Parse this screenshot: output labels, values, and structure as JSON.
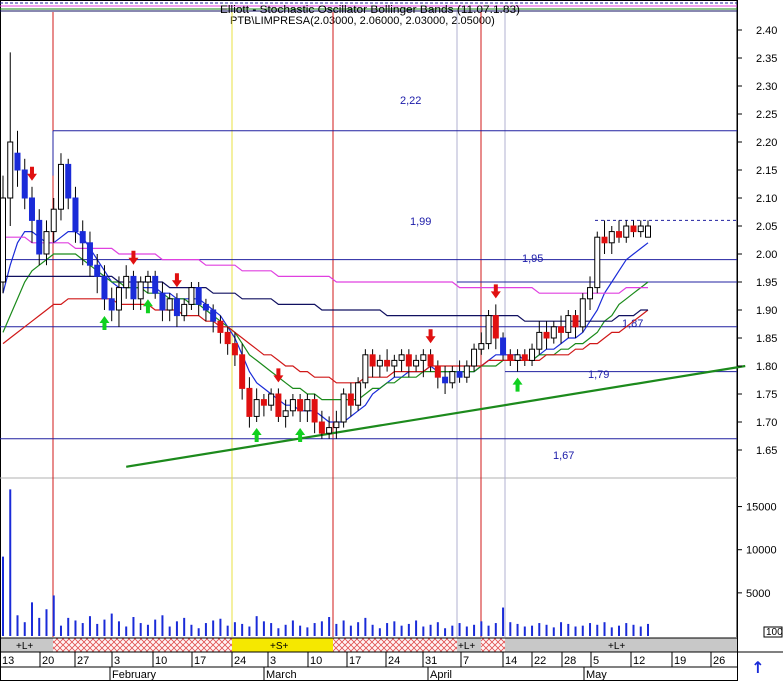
{
  "header": {
    "overlay_text": "Elliott - Stochastic Oscillator Bollinger Bands (11.07.1.83)",
    "instrument": "PTB\\LIMPRESA(2.03000, 2.06000, 2.03000, 2.05000)"
  },
  "colors": {
    "up_candle": "#ffffff",
    "down_candle_a": "#1a2bd8",
    "down_candle_b": "#e01010",
    "ma_fast": "#1a2bd8",
    "ma_mid": "#1a8a1a",
    "ma_slow": "#d01818",
    "ma_long": "#101060",
    "ma_envelope": "#e040e0",
    "trendline": "#1c8a1c",
    "level_line": "#2020a0",
    "vline_red": "#d01818",
    "vline_yellow": "#e8e040",
    "buy_arrow": "#10d020",
    "sell_arrow": "#e01010"
  },
  "signal_band": {
    "labels": [
      "+L+",
      "+S+",
      "+L+",
      "+L+"
    ],
    "zoom_label": "100"
  },
  "scroll_up_icon": "↑",
  "chart_data": {
    "type": "candlestick",
    "title": "PTB\\LIMPRESA(2.03000, 2.06000, 2.03000, 2.05000)",
    "price_axis": {
      "ticks": [
        "2.40",
        "2.35",
        "2.30",
        "2.25",
        "2.20",
        "2.15",
        "2.10",
        "2.05",
        "2.00",
        "1.95",
        "1.90",
        "1.85",
        "1.80",
        "1.75",
        "1.70",
        "1.65"
      ],
      "ylim": [
        1.63,
        2.44
      ],
      "position": "right"
    },
    "volume_axis": {
      "ticks": [
        "15000",
        "10000",
        "5000"
      ],
      "ylim": [
        0,
        17500
      ],
      "position": "right"
    },
    "x_axis": {
      "day_labels": [
        "13",
        "20",
        "27",
        "3",
        "10",
        "17",
        "24",
        "3",
        "10",
        "17",
        "24",
        "31",
        "7",
        "14",
        "22",
        "28",
        "5",
        "12",
        "19",
        "26"
      ],
      "month_labels": [
        "February",
        "March",
        "April",
        "May"
      ]
    },
    "levels": [
      {
        "value": 2.22,
        "label": "2,22"
      },
      {
        "value": 1.99,
        "label": "1,99"
      },
      {
        "value": 1.95,
        "label": "1,95"
      },
      {
        "value": 1.87,
        "label": "1,87"
      },
      {
        "value": 1.79,
        "label": "1,79"
      },
      {
        "value": 1.67,
        "label": "1,67"
      }
    ],
    "candles": [
      [
        1.95,
        2.14,
        1.93,
        2.1
      ],
      [
        2.1,
        2.36,
        2.05,
        2.2
      ],
      [
        2.18,
        2.22,
        2.12,
        2.15
      ],
      [
        2.15,
        2.17,
        2.08,
        2.1
      ],
      [
        2.1,
        2.12,
        2.02,
        2.06
      ],
      [
        2.06,
        2.08,
        1.98,
        2.0
      ],
      [
        2.0,
        2.06,
        1.98,
        2.04
      ],
      [
        2.04,
        2.1,
        2.02,
        2.08
      ],
      [
        2.08,
        2.18,
        2.06,
        2.16
      ],
      [
        2.16,
        2.17,
        2.08,
        2.1
      ],
      [
        2.1,
        2.12,
        2.02,
        2.04
      ],
      [
        2.04,
        2.06,
        1.98,
        2.02
      ],
      [
        2.02,
        2.04,
        1.96,
        1.98
      ],
      [
        1.98,
        2.0,
        1.93,
        1.96
      ],
      [
        1.96,
        1.98,
        1.9,
        1.92
      ],
      [
        1.92,
        1.94,
        1.88,
        1.9
      ],
      [
        1.9,
        1.96,
        1.87,
        1.94
      ],
      [
        1.94,
        1.98,
        1.92,
        1.96
      ],
      [
        1.96,
        1.97,
        1.9,
        1.92
      ],
      [
        1.92,
        1.96,
        1.9,
        1.95
      ],
      [
        1.95,
        1.97,
        1.93,
        1.96
      ],
      [
        1.96,
        1.97,
        1.92,
        1.93
      ],
      [
        1.93,
        1.95,
        1.88,
        1.9
      ],
      [
        1.9,
        1.93,
        1.88,
        1.92
      ],
      [
        1.92,
        1.93,
        1.87,
        1.89
      ],
      [
        1.89,
        1.92,
        1.88,
        1.91
      ],
      [
        1.91,
        1.95,
        1.9,
        1.94
      ],
      [
        1.94,
        1.95,
        1.89,
        1.91
      ],
      [
        1.91,
        1.92,
        1.88,
        1.9
      ],
      [
        1.9,
        1.91,
        1.86,
        1.88
      ],
      [
        1.88,
        1.89,
        1.84,
        1.86
      ],
      [
        1.86,
        1.87,
        1.82,
        1.84
      ],
      [
        1.84,
        1.86,
        1.8,
        1.82
      ],
      [
        1.82,
        1.84,
        1.74,
        1.76
      ],
      [
        1.76,
        1.78,
        1.69,
        1.71
      ],
      [
        1.71,
        1.76,
        1.7,
        1.74
      ],
      [
        1.74,
        1.75,
        1.71,
        1.73
      ],
      [
        1.73,
        1.76,
        1.72,
        1.75
      ],
      [
        1.75,
        1.76,
        1.7,
        1.71
      ],
      [
        1.71,
        1.74,
        1.69,
        1.72
      ],
      [
        1.72,
        1.75,
        1.71,
        1.74
      ],
      [
        1.74,
        1.75,
        1.7,
        1.72
      ],
      [
        1.72,
        1.75,
        1.7,
        1.74
      ],
      [
        1.74,
        1.75,
        1.68,
        1.7
      ],
      [
        1.7,
        1.72,
        1.67,
        1.68
      ],
      [
        1.68,
        1.71,
        1.67,
        1.69
      ],
      [
        1.69,
        1.72,
        1.67,
        1.7
      ],
      [
        1.7,
        1.76,
        1.69,
        1.75
      ],
      [
        1.75,
        1.77,
        1.71,
        1.73
      ],
      [
        1.73,
        1.78,
        1.72,
        1.77
      ],
      [
        1.77,
        1.83,
        1.76,
        1.82
      ],
      [
        1.82,
        1.83,
        1.78,
        1.8
      ],
      [
        1.8,
        1.82,
        1.78,
        1.81
      ],
      [
        1.81,
        1.83,
        1.79,
        1.8
      ],
      [
        1.8,
        1.82,
        1.78,
        1.81
      ],
      [
        1.81,
        1.83,
        1.79,
        1.82
      ],
      [
        1.82,
        1.83,
        1.78,
        1.8
      ],
      [
        1.8,
        1.82,
        1.79,
        1.81
      ],
      [
        1.81,
        1.83,
        1.78,
        1.82
      ],
      [
        1.82,
        1.83,
        1.79,
        1.8
      ],
      [
        1.8,
        1.81,
        1.76,
        1.78
      ],
      [
        1.78,
        1.8,
        1.75,
        1.77
      ],
      [
        1.77,
        1.8,
        1.76,
        1.79
      ],
      [
        1.79,
        1.81,
        1.77,
        1.78
      ],
      [
        1.78,
        1.81,
        1.77,
        1.8
      ],
      [
        1.8,
        1.84,
        1.79,
        1.83
      ],
      [
        1.83,
        1.86,
        1.82,
        1.84
      ],
      [
        1.84,
        1.9,
        1.83,
        1.89
      ],
      [
        1.89,
        1.91,
        1.83,
        1.85
      ],
      [
        1.85,
        1.86,
        1.81,
        1.82
      ],
      [
        1.82,
        1.83,
        1.8,
        1.81
      ],
      [
        1.81,
        1.83,
        1.79,
        1.82
      ],
      [
        1.82,
        1.83,
        1.8,
        1.81
      ],
      [
        1.81,
        1.84,
        1.8,
        1.83
      ],
      [
        1.83,
        1.88,
        1.82,
        1.86
      ],
      [
        1.86,
        1.88,
        1.83,
        1.85
      ],
      [
        1.85,
        1.88,
        1.84,
        1.87
      ],
      [
        1.87,
        1.89,
        1.84,
        1.86
      ],
      [
        1.86,
        1.9,
        1.85,
        1.89
      ],
      [
        1.89,
        1.9,
        1.85,
        1.87
      ],
      [
        1.87,
        1.93,
        1.86,
        1.92
      ],
      [
        1.92,
        1.96,
        1.9,
        1.94
      ],
      [
        1.94,
        2.04,
        1.93,
        2.03
      ],
      [
        2.03,
        2.06,
        2.0,
        2.02
      ],
      [
        2.02,
        2.05,
        2.0,
        2.04
      ],
      [
        2.04,
        2.06,
        2.02,
        2.03
      ],
      [
        2.03,
        2.06,
        2.02,
        2.05
      ],
      [
        2.05,
        2.06,
        2.03,
        2.04
      ],
      [
        2.04,
        2.06,
        2.03,
        2.05
      ],
      [
        2.03,
        2.06,
        2.03,
        2.05
      ]
    ],
    "volume": [
      9200,
      17000,
      2400,
      1600,
      3900,
      2100,
      3100,
      4700,
      1200,
      2100,
      1800,
      1500,
      2300,
      1400,
      1900,
      2600,
      1700,
      1100,
      2200,
      1500,
      1300,
      1900,
      2400,
      1100,
      1700,
      2100,
      1300,
      900,
      1500,
      1800,
      2000,
      1200,
      1600,
      1400,
      1100,
      2300,
      1700,
      1500,
      900,
      1300,
      1800,
      1200,
      1000,
      1500,
      1700,
      2200,
      1400,
      1800,
      1200,
      1600,
      2100,
      1300,
      900,
      1500,
      1700,
      1200,
      1400,
      1800,
      1100,
      1300,
      1600,
      900,
      1200,
      1500,
      1100,
      1300,
      1700,
      1200,
      1500,
      3300,
      1600,
      1400,
      1100,
      1200,
      1500,
      1300,
      1000,
      1600,
      1400,
      1100,
      1200,
      1500,
      1300,
      1600,
      1000,
      1200,
      1500,
      1300,
      1100,
      1400
    ],
    "series": [
      {
        "values": [
          1.93,
          1.98,
          2.02,
          2.04,
          2.04,
          2.03,
          2.02,
          2.02,
          2.03,
          2.04,
          2.04,
          2.03,
          2.01,
          1.99,
          1.97,
          1.95,
          1.94,
          1.94,
          1.94,
          1.94,
          1.94,
          1.94,
          1.93,
          1.93,
          1.92,
          1.92,
          1.92,
          1.92,
          1.91,
          1.9,
          1.89,
          1.87,
          1.85,
          1.82,
          1.79,
          1.77,
          1.76,
          1.75,
          1.74,
          1.73,
          1.73,
          1.72,
          1.72,
          1.72,
          1.71,
          1.7,
          1.7,
          1.7,
          1.71,
          1.72,
          1.73,
          1.75,
          1.76,
          1.77,
          1.78,
          1.78,
          1.79,
          1.79,
          1.79,
          1.8,
          1.79,
          1.79,
          1.79,
          1.79,
          1.79,
          1.79,
          1.8,
          1.81,
          1.82,
          1.82,
          1.82,
          1.82,
          1.81,
          1.81,
          1.82,
          1.83,
          1.83,
          1.84,
          1.85,
          1.85,
          1.86,
          1.88,
          1.9,
          1.93,
          1.95,
          1.97,
          1.99,
          2.0,
          2.01,
          2.02
        ]
      },
      {
        "values": [
          1.86,
          1.89,
          1.92,
          1.95,
          1.97,
          1.98,
          1.99,
          2.0,
          2.0,
          2.0,
          2.0,
          1.99,
          1.98,
          1.97,
          1.96,
          1.95,
          1.95,
          1.94,
          1.94,
          1.94,
          1.93,
          1.93,
          1.93,
          1.92,
          1.92,
          1.92,
          1.91,
          1.91,
          1.9,
          1.89,
          1.88,
          1.87,
          1.86,
          1.84,
          1.82,
          1.81,
          1.8,
          1.79,
          1.78,
          1.77,
          1.76,
          1.76,
          1.75,
          1.75,
          1.74,
          1.74,
          1.74,
          1.74,
          1.74,
          1.74,
          1.75,
          1.76,
          1.76,
          1.77,
          1.77,
          1.78,
          1.78,
          1.78,
          1.79,
          1.79,
          1.79,
          1.79,
          1.79,
          1.79,
          1.79,
          1.79,
          1.8,
          1.8,
          1.8,
          1.81,
          1.81,
          1.81,
          1.81,
          1.81,
          1.82,
          1.82,
          1.82,
          1.83,
          1.83,
          1.84,
          1.84,
          1.85,
          1.86,
          1.88,
          1.89,
          1.91,
          1.92,
          1.93,
          1.94,
          1.95
        ]
      },
      {
        "values": [
          1.84,
          1.85,
          1.86,
          1.87,
          1.88,
          1.89,
          1.9,
          1.91,
          1.91,
          1.92,
          1.92,
          1.92,
          1.92,
          1.92,
          1.92,
          1.92,
          1.91,
          1.91,
          1.91,
          1.91,
          1.91,
          1.9,
          1.9,
          1.9,
          1.9,
          1.89,
          1.89,
          1.89,
          1.88,
          1.88,
          1.87,
          1.87,
          1.86,
          1.85,
          1.84,
          1.83,
          1.82,
          1.82,
          1.81,
          1.8,
          1.8,
          1.79,
          1.79,
          1.78,
          1.78,
          1.78,
          1.77,
          1.77,
          1.77,
          1.77,
          1.78,
          1.78,
          1.78,
          1.78,
          1.79,
          1.79,
          1.79,
          1.79,
          1.79,
          1.8,
          1.8,
          1.8,
          1.8,
          1.8,
          1.8,
          1.8,
          1.8,
          1.81,
          1.81,
          1.81,
          1.81,
          1.81,
          1.81,
          1.81,
          1.81,
          1.82,
          1.82,
          1.82,
          1.82,
          1.83,
          1.83,
          1.84,
          1.84,
          1.85,
          1.86,
          1.86,
          1.87,
          1.88,
          1.89,
          1.9
        ]
      },
      {
        "values": [
          1.96,
          1.96,
          1.96,
          1.96,
          1.96,
          1.96,
          1.96,
          1.96,
          1.96,
          1.96,
          1.96,
          1.96,
          1.96,
          1.96,
          1.96,
          1.96,
          1.95,
          1.95,
          1.95,
          1.95,
          1.95,
          1.95,
          1.95,
          1.94,
          1.94,
          1.94,
          1.94,
          1.94,
          1.94,
          1.93,
          1.93,
          1.93,
          1.93,
          1.92,
          1.92,
          1.92,
          1.92,
          1.92,
          1.91,
          1.91,
          1.91,
          1.91,
          1.91,
          1.91,
          1.9,
          1.9,
          1.9,
          1.9,
          1.9,
          1.9,
          1.9,
          1.9,
          1.9,
          1.89,
          1.89,
          1.89,
          1.89,
          1.89,
          1.89,
          1.89,
          1.89,
          1.89,
          1.89,
          1.89,
          1.89,
          1.89,
          1.89,
          1.89,
          1.89,
          1.89,
          1.89,
          1.89,
          1.88,
          1.88,
          1.88,
          1.88,
          1.88,
          1.88,
          1.88,
          1.88,
          1.88,
          1.88,
          1.88,
          1.88,
          1.88,
          1.89,
          1.89,
          1.89,
          1.9,
          1.9
        ]
      },
      {
        "values": [
          2.03,
          2.03,
          2.03,
          2.03,
          2.02,
          2.02,
          2.02,
          2.02,
          2.02,
          2.02,
          2.01,
          2.01,
          2.01,
          2.01,
          2.01,
          2.01,
          2.0,
          2.0,
          2.0,
          2.0,
          2.0,
          2.0,
          1.99,
          1.99,
          1.99,
          1.99,
          1.99,
          1.99,
          1.98,
          1.98,
          1.98,
          1.98,
          1.98,
          1.97,
          1.97,
          1.97,
          1.97,
          1.97,
          1.96,
          1.96,
          1.96,
          1.96,
          1.96,
          1.96,
          1.96,
          1.96,
          1.95,
          1.95,
          1.95,
          1.95,
          1.95,
          1.95,
          1.95,
          1.95,
          1.95,
          1.95,
          1.95,
          1.95,
          1.95,
          1.95,
          1.95,
          1.95,
          1.95,
          1.94,
          1.94,
          1.94,
          1.94,
          1.94,
          1.94,
          1.94,
          1.94,
          1.94,
          1.94,
          1.94,
          1.93,
          1.93,
          1.93,
          1.93,
          1.93,
          1.93,
          1.93,
          1.93,
          1.93,
          1.93,
          1.93,
          1.93,
          1.94,
          1.94,
          1.94,
          1.94
        ]
      }
    ],
    "trendline": {
      "from": [
        17,
        1.62
      ],
      "to": [
        90,
        1.8
      ]
    },
    "buy_signals": [
      14,
      20,
      35,
      41,
      71
    ],
    "sell_signals": [
      4,
      18,
      24,
      38,
      59,
      68
    ],
    "grid": false,
    "legend": "none"
  }
}
